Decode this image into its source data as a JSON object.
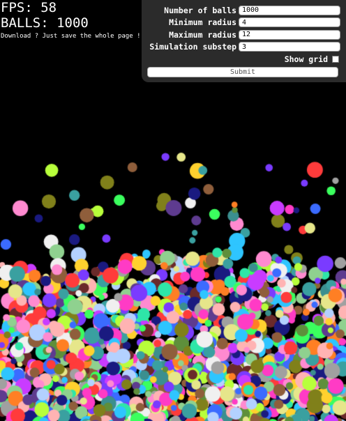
{
  "stats": {
    "fps": "FPS: 58",
    "balls": "BALLS: 1000",
    "hint": "Download ? Just save the whole page !"
  },
  "form": {
    "num_balls_label": "Number of balls",
    "num_balls_value": "1000",
    "min_radius_label": "Minimum radius",
    "min_radius_value": "4",
    "max_radius_label": "Maximum radius",
    "max_radius_value": "12",
    "substep_label": "Simulation substep",
    "substep_value": "3",
    "show_grid_label": "Show grid",
    "show_grid_checked": false,
    "submit_label": "Submit"
  },
  "simulation": {
    "background": "#000000",
    "palette": [
      "#ff3b3b",
      "#ff7f24",
      "#ffd12e",
      "#b8ff3b",
      "#3bff5e",
      "#2ee6a8",
      "#2ec5ff",
      "#3b6bff",
      "#7a3bff",
      "#c93bff",
      "#ff3bc5",
      "#ff8ad0",
      "#a0a0a0",
      "#f0f0f0",
      "#5e8f3b",
      "#8f5e3b",
      "#3b8f8f",
      "#5e3b8f",
      "#8fd18f",
      "#ffb3b3",
      "#b3d1ff",
      "#e6e68a",
      "#1a1a80",
      "#80801a",
      "#6a2a2a",
      "#3aa0a0"
    ]
  }
}
